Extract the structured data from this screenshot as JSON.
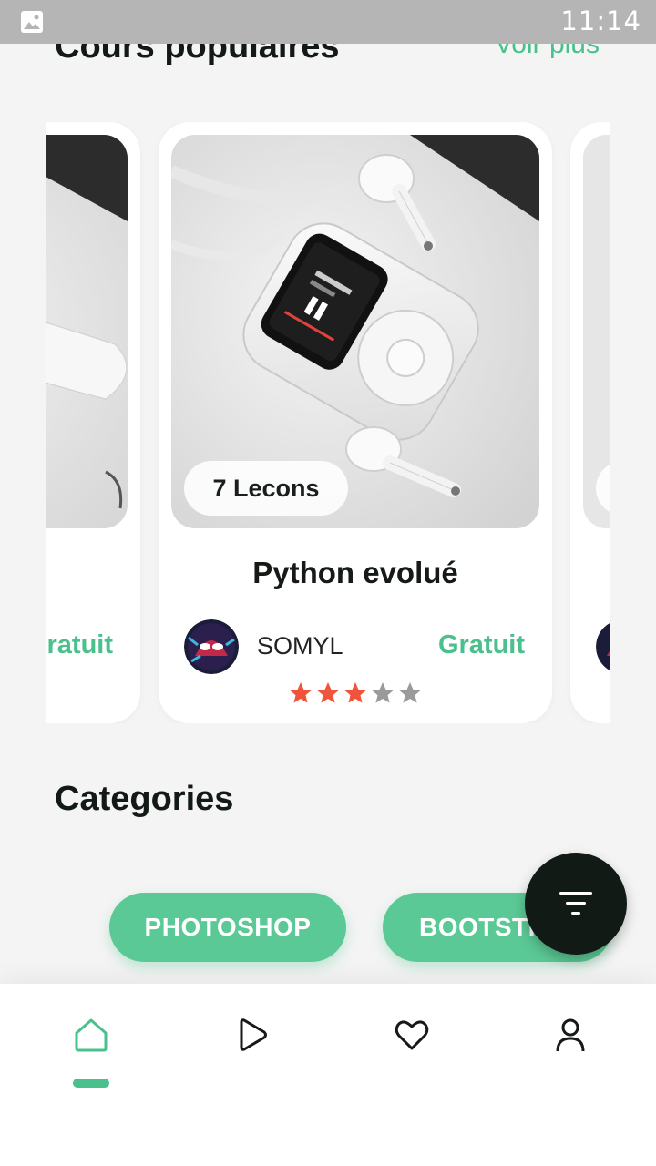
{
  "status_bar": {
    "time": "11:14"
  },
  "popular": {
    "title": "Cours populaires",
    "see_more": "Voir plus"
  },
  "cards": [
    {
      "price": "Gratuit"
    },
    {
      "lessons": "7 Lecons",
      "title": "Python evolué",
      "author": "SOMYL",
      "price": "Gratuit",
      "rating": 3,
      "max_rating": 5
    }
  ],
  "categories": {
    "title": "Categories",
    "chips": [
      "PHOTOSHOP",
      "BOOTSTRAP"
    ]
  },
  "colors": {
    "accent": "#4ac08d",
    "chip": "#5bc995",
    "fab": "#121a15",
    "star_on": "#f0543a",
    "star_off": "#9a9a9a"
  },
  "nav": {
    "items": [
      "home-icon",
      "play-icon",
      "heart-icon",
      "user-icon"
    ],
    "active": "home-icon"
  }
}
